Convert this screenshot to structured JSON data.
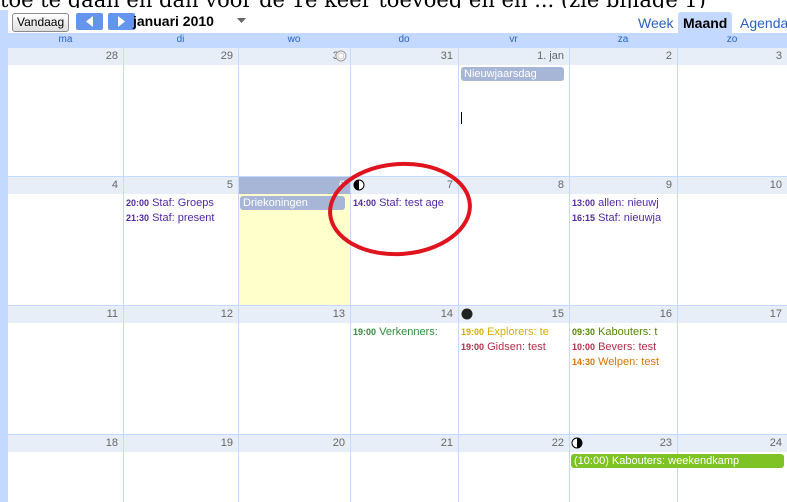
{
  "toolbar": {
    "today_label": "Vandaag",
    "month_title": "januari 2010",
    "prev_icon": "chevron-left-icon",
    "next_icon": "chevron-right-icon",
    "views": [
      {
        "label": "Week",
        "active": false
      },
      {
        "label": "Maand",
        "active": true
      },
      {
        "label": "Agenda",
        "active": false
      }
    ]
  },
  "weekdays": [
    "ma",
    "di",
    "wo",
    "do",
    "vr",
    "za",
    "zo"
  ],
  "weeks": [
    {
      "days": [
        "28",
        "29",
        "30",
        "31",
        "1. jan",
        "2",
        "3"
      ]
    },
    {
      "days": [
        "4",
        "5",
        "6",
        "7",
        "8",
        "9",
        "10"
      ]
    },
    {
      "days": [
        "11",
        "12",
        "13",
        "14",
        "15",
        "16",
        "17"
      ]
    },
    {
      "days": [
        "18",
        "19",
        "20",
        "21",
        "22",
        "23",
        "24"
      ]
    }
  ],
  "events": {
    "nieuwjaarsdag": "Nieuwjaarsdag",
    "driekoningen": "Driekoningen",
    "di5_1_time": "20:00",
    "di5_1_text": "Staf: Groeps",
    "di5_2_time": "21:30",
    "di5_2_text": "Staf: present",
    "do7_1_time": "14:00",
    "do7_1_text": "Staf: test age",
    "za9_1_time": "13:00",
    "za9_1_text": "allen: nieuwj",
    "za9_2_time": "16:15",
    "za9_2_text": "Staf: nieuwja",
    "do14_1_time": "19:00",
    "do14_1_text": "Verkenners:",
    "vr15_1_time": "19:00",
    "vr15_1_text": "Explorers: te",
    "vr15_2_time": "19:00",
    "vr15_2_text": "Gidsen: test",
    "za16_1_time": "09:30",
    "za16_1_text": "Kabouters: t",
    "za16_2_time": "10:00",
    "za16_2_text": "Bevers: test",
    "za16_3_time": "14:30",
    "za16_3_text": "Welpen: test",
    "weekendkamp": "(10:00) Kabouters: weekendkamp"
  },
  "colors": {
    "header_bg": "#c3d9ff",
    "today_bg": "#ffffcc",
    "holiday_bar": "#a7b6d6",
    "staf": "#5229a3",
    "verkenners": "#2f8b3b",
    "explorers": "#d6ae00",
    "gidsen": "#b32d48",
    "kabouters": "#528800",
    "bevers": "#b32d48",
    "welpen": "#d47500",
    "annotation_circle": "#e0141e"
  },
  "moon_icons": [
    "full-moon-icon",
    "first-quarter-moon-icon",
    "new-moon-icon",
    "last-quarter-moon-icon"
  ]
}
